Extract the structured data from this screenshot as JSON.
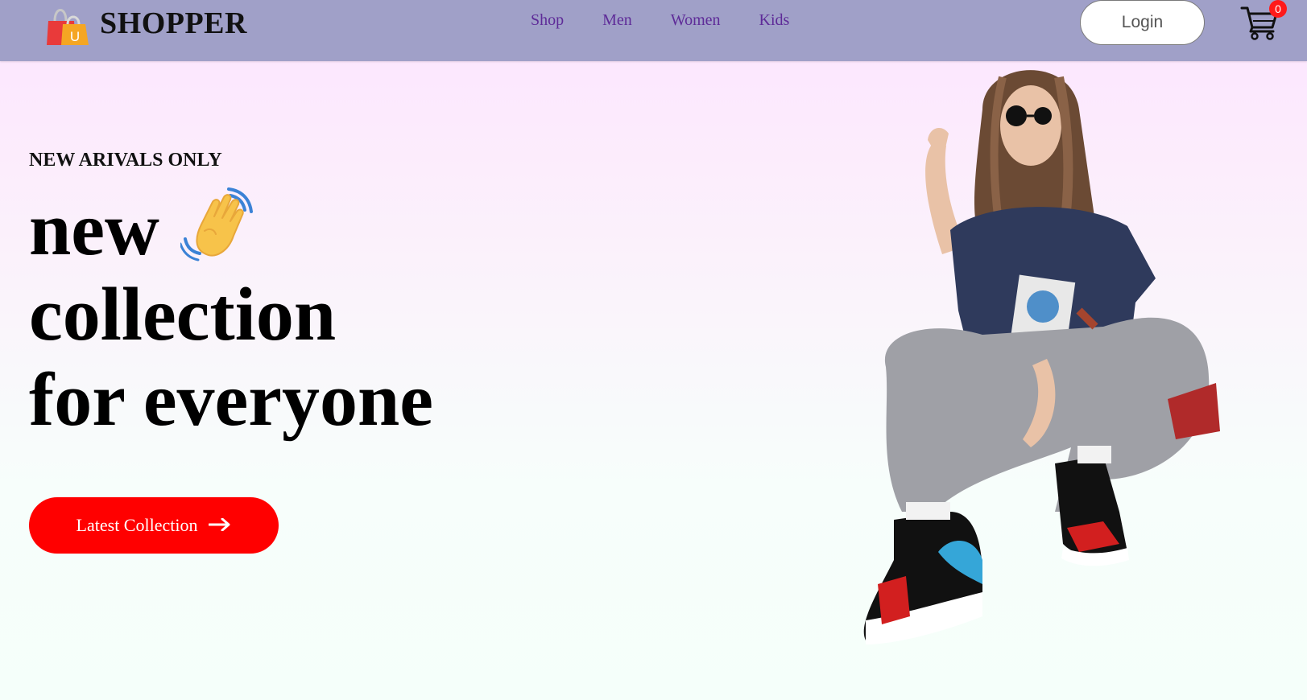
{
  "navbar": {
    "brand": "SHOPPER",
    "logo_letter": "U",
    "menu": [
      "Shop",
      "Men",
      "Women",
      "Kids"
    ],
    "login_label": "Login",
    "cart_count": "0"
  },
  "hero": {
    "tagline": "NEW ARIVALS ONLY",
    "heading_lines": [
      "new",
      "collection",
      "for everyone"
    ],
    "cta_label": "Latest Collection"
  },
  "icons": {
    "logo": "shopping-bag-icon",
    "cart": "cart-icon",
    "wave": "waving-hand-icon",
    "cta_arrow": "arrow-right-icon"
  },
  "colors": {
    "navbar": "#a0a0c8",
    "nav_link": "#5e2b98",
    "cta": "#ff0000",
    "badge": "#ff1a1a"
  }
}
